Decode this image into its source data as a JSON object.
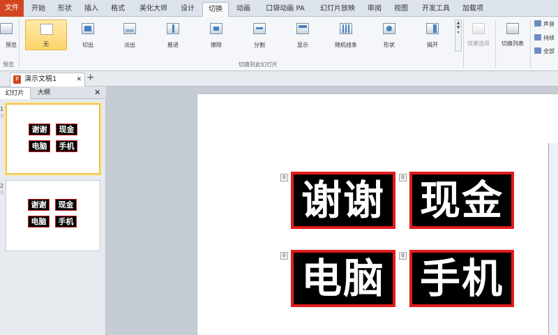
{
  "menu": {
    "file": "文件",
    "tabs": [
      "开始",
      "形状",
      "插入",
      "格式",
      "美化大师",
      "设计",
      "切换",
      "动画",
      "口袋动画 PA",
      "幻灯片放映",
      "审阅",
      "视图",
      "开发工具",
      "加载项"
    ],
    "active_tab": "切换"
  },
  "ribbon": {
    "preview_label": "预览",
    "preview_group": "预览",
    "transitions": [
      "无",
      "切出",
      "淡出",
      "推进",
      "擦除",
      "分割",
      "显示",
      "随机线条",
      "形状",
      "揭开"
    ],
    "selected_transition": "无",
    "effect_options": "效果选项",
    "transition_list": "切换列表",
    "transition_group": "切换到此幻灯片",
    "sound": "声音",
    "duration": "持续",
    "apply_all": "全部"
  },
  "document_tab": {
    "title": "演示文稿1",
    "add": "+"
  },
  "left_pane": {
    "tabs": [
      "幻灯片",
      "大纲"
    ],
    "close": "✕",
    "slides": [
      {
        "number": "1",
        "words": [
          "谢谢",
          "现金",
          "电脑",
          "手机"
        ]
      },
      {
        "number": "2",
        "words": [
          "谢谢",
          "现金",
          "电脑",
          "手机"
        ]
      }
    ]
  },
  "slide": {
    "words": [
      "谢谢",
      "现金",
      "电脑",
      "手机"
    ],
    "badge": "0"
  },
  "colors": {
    "accent": "#d2461f",
    "word_border": "#e21b1b",
    "word_bg": "#000000"
  }
}
